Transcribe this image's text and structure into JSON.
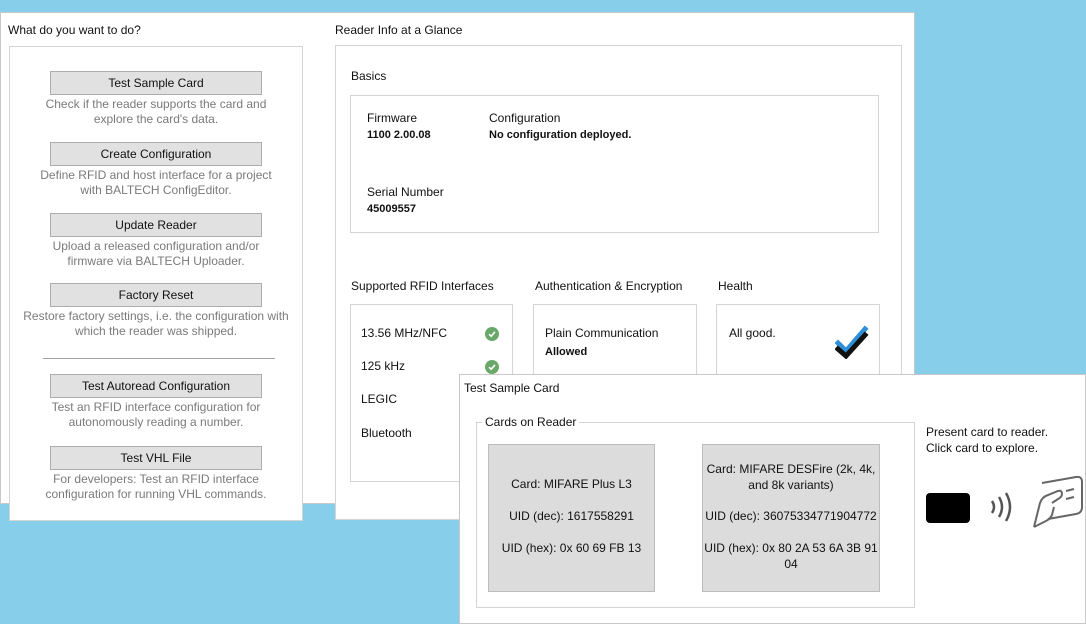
{
  "left": {
    "title": "What do you want to do?",
    "actions": [
      {
        "label": "Test Sample Card",
        "desc": "Check if the reader supports the card and explore the card's data."
      },
      {
        "label": "Create Configuration",
        "desc": "Define RFID and host interface for a project with BALTECH ConfigEditor."
      },
      {
        "label": "Update Reader",
        "desc": "Upload a released configuration and/or firmware via BALTECH Uploader."
      },
      {
        "label": "Factory Reset",
        "desc": "Restore factory settings, i.e. the configuration with which the reader was shipped."
      },
      {
        "label": "Test Autoread Configuration",
        "desc": "Test an RFID interface configuration for autonomously reading a number."
      },
      {
        "label": "Test VHL File",
        "desc": "For developers: Test an RFID interface configuration for running VHL commands."
      }
    ]
  },
  "reader": {
    "title": "Reader Info at a Glance",
    "basics": {
      "title": "Basics",
      "firmware_label": "Firmware",
      "firmware_value": "1100 2.00.08",
      "config_label": "Configuration",
      "config_value": "No configuration deployed.",
      "serial_label": "Serial Number",
      "serial_value": "45009557"
    },
    "rfid": {
      "title": "Supported RFID Interfaces",
      "items": [
        {
          "label": "13.56 MHz/NFC",
          "supported": true
        },
        {
          "label": "125 kHz",
          "supported": true
        },
        {
          "label": "LEGIC",
          "supported": null
        },
        {
          "label": "Bluetooth",
          "supported": null
        }
      ]
    },
    "auth": {
      "title": "Authentication & Encryption",
      "label": "Plain Communication",
      "value": "Allowed"
    },
    "health": {
      "title": "Health",
      "value": "All good.",
      "icon": "double-check-icon"
    }
  },
  "test_dialog": {
    "title": "Test Sample Card",
    "group_title": "Cards on Reader",
    "cards": [
      {
        "name": "Card: MIFARE Plus L3",
        "uid_dec": "UID (dec): 1617558291",
        "uid_hex": "UID (hex): 0x 60 69 FB 13"
      },
      {
        "name_line1": "Card: MIFARE DESFire (2k, 4k,",
        "name_line2": "and 8k variants)",
        "uid_dec": "UID (dec): 36075334771904772",
        "uid_hex_line1": "UID (hex): 0x 80 2A 53 6A 3B 91",
        "uid_hex_line2": "04"
      }
    ],
    "hint_line1": "Present card to reader.",
    "hint_line2": "Click card to explore.",
    "icons": [
      "card-icon",
      "signal-waves-icon",
      "hand-card-icon"
    ]
  },
  "colors": {
    "background": "#87ceeb",
    "ok_green": "#6aa86a",
    "check_blue": "#2f8fd8"
  }
}
